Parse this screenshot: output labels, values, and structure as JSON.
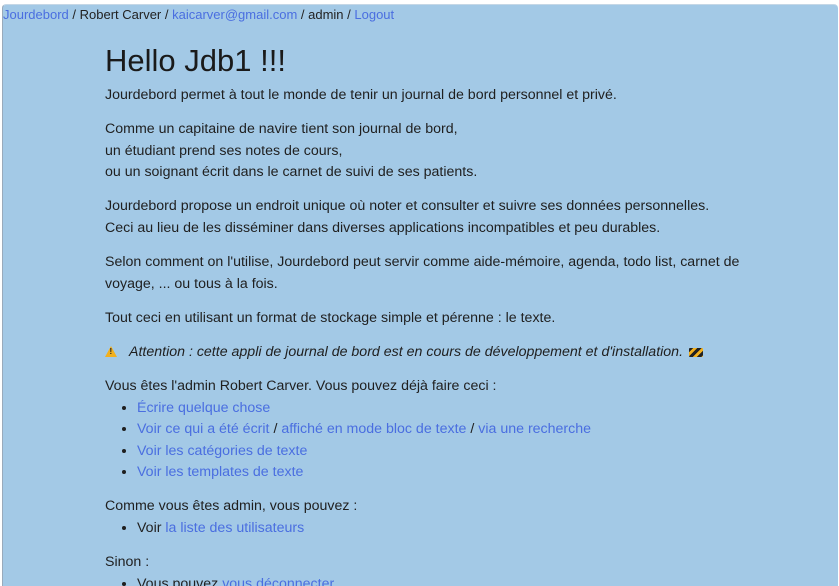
{
  "nav": {
    "brand": "Jourdebord",
    "sep1": " / ",
    "user_name": "Robert Carver",
    "sep2": " / ",
    "email": "kaicarver@gmail.com",
    "sep3": " / ",
    "role": "admin",
    "sep4": " / ",
    "logout": "Logout"
  },
  "heading": "Hello Jdb1 !!!",
  "intro": "Jourdebord permet à tout le monde de tenir un journal de bord personnel et privé.",
  "comparison": [
    "Comme un capitaine de navire tient son journal de bord,",
    "un étudiant prend ses notes de cours,",
    "ou un soignant écrit dans le carnet de suivi de ses patients."
  ],
  "purpose": [
    "Jourdebord propose un endroit unique où noter et consulter et suivre ses données personnelles.",
    "Ceci au lieu de les disséminer dans diverses applications incompatibles et peu durables."
  ],
  "usage": "Selon comment on l'utilise, Jourdebord peut servir comme aide-mémoire, agenda, todo list, carnet de voyage, ... ou tous à la fois.",
  "format": "Tout ceci en utilisant un format de stockage simple et pérenne : le texte.",
  "warning": {
    "icon": "warning-icon",
    "text": "Attention : cette appli de journal de bord est en cours de développement et d'installation.",
    "trailing_icon": "construction-icon"
  },
  "admin_intro": "Vous êtes l'admin Robert Carver. Vous pouvez déjà faire ceci :",
  "actions": {
    "write": "Écrire quelque chose",
    "view_written": "Voir ce qui a été écrit",
    "slash1": " / ",
    "block_mode": "affiché en mode bloc de texte",
    "slash2": " / ",
    "search": "via une recherche",
    "categories": "Voir les catégories de texte",
    "templates": "Voir les templates de texte"
  },
  "admin_section": {
    "intro": "Comme vous êtes admin, vous pouvez :",
    "prefix": "Voir ",
    "users_link": "la liste des utilisateurs"
  },
  "otherwise": {
    "intro": "Sinon :",
    "prefix": "Vous pouvez ",
    "logout_link": "vous déconnecter"
  },
  "colors": {
    "background": "#a3c9e6",
    "link": "#4a6ee0",
    "text": "#1f1f1f"
  }
}
